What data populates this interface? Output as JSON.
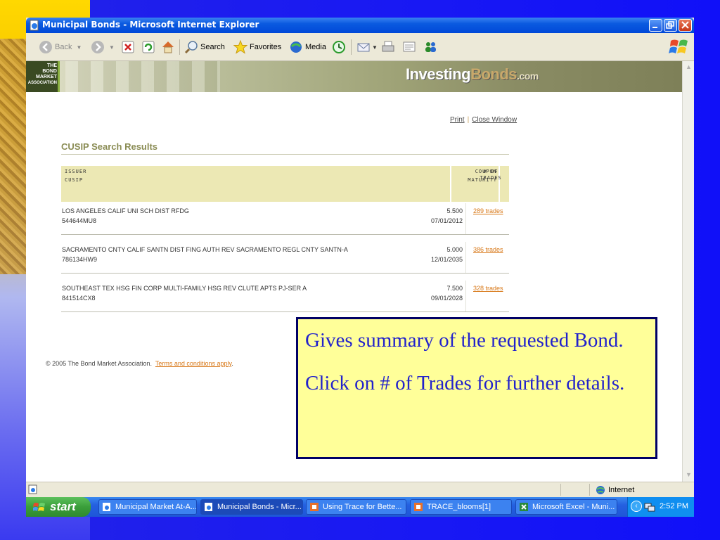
{
  "window": {
    "title": "Municipal Bonds - Microsoft Internet Explorer"
  },
  "toolbar": {
    "back": "Back",
    "search": "Search",
    "favorites": "Favorites",
    "media": "Media"
  },
  "banner": {
    "logo_lines": [
      "THE",
      "BOND",
      "MARKET",
      "ASSOCIATION"
    ],
    "brand_main": "Investing",
    "brand_accent": "Bonds",
    "brand_suffix": ".com"
  },
  "utility_links": {
    "print": "Print",
    "close": "Close Window"
  },
  "results": {
    "title": "CUSIP Search Results",
    "headers": {
      "issuer": "ISSUER",
      "cusip": "CUSIP",
      "coupon": "COUPON",
      "maturity": "MATURITY",
      "trades_line1": "# OF",
      "trades_line2": "TRADES"
    },
    "rows": [
      {
        "issuer": "LOS ANGELES CALIF UNI SCH DIST RFDG",
        "cusip": "544644MU8",
        "coupon": "5.500",
        "maturity": "07/01/2012",
        "trades": "289 trades"
      },
      {
        "issuer": "SACRAMENTO CNTY CALIF SANTN DIST FING AUTH REV SACRAMENTO REGL CNTY SANTN-A",
        "cusip": "786134HW9",
        "coupon": "5.000",
        "maturity": "12/01/2035",
        "trades": "386 trades"
      },
      {
        "issuer": "SOUTHEAST TEX HSG FIN CORP MULTI-FAMILY HSG REV CLUTE APTS PJ-SER A",
        "cusip": "841514CX8",
        "coupon": "7.500",
        "maturity": "09/01/2028",
        "trades": "328 trades"
      }
    ]
  },
  "footer": {
    "copyright": "© 2005 The Bond Market Association.",
    "terms": "Terms and conditions apply",
    "period": "."
  },
  "statusbar": {
    "zone": "Internet"
  },
  "taskbar": {
    "start": "start",
    "tasks": [
      "Municipal Market At-A...",
      "Municipal Bonds - Micr...",
      "Using Trace for Bette...",
      "TRACE_blooms[1]",
      "Microsoft Excel - Muni..."
    ],
    "clock": "2:52 PM"
  },
  "callout": {
    "line1": "Gives summary of the requested Bond.",
    "line2": "Click on # of Trades for further details."
  },
  "colors": {
    "callout_bg": "#ffff99",
    "callout_text": "#2222cc",
    "callout_border": "#000066",
    "link_orange": "#d87818",
    "header_olive": "#8a8c54"
  }
}
